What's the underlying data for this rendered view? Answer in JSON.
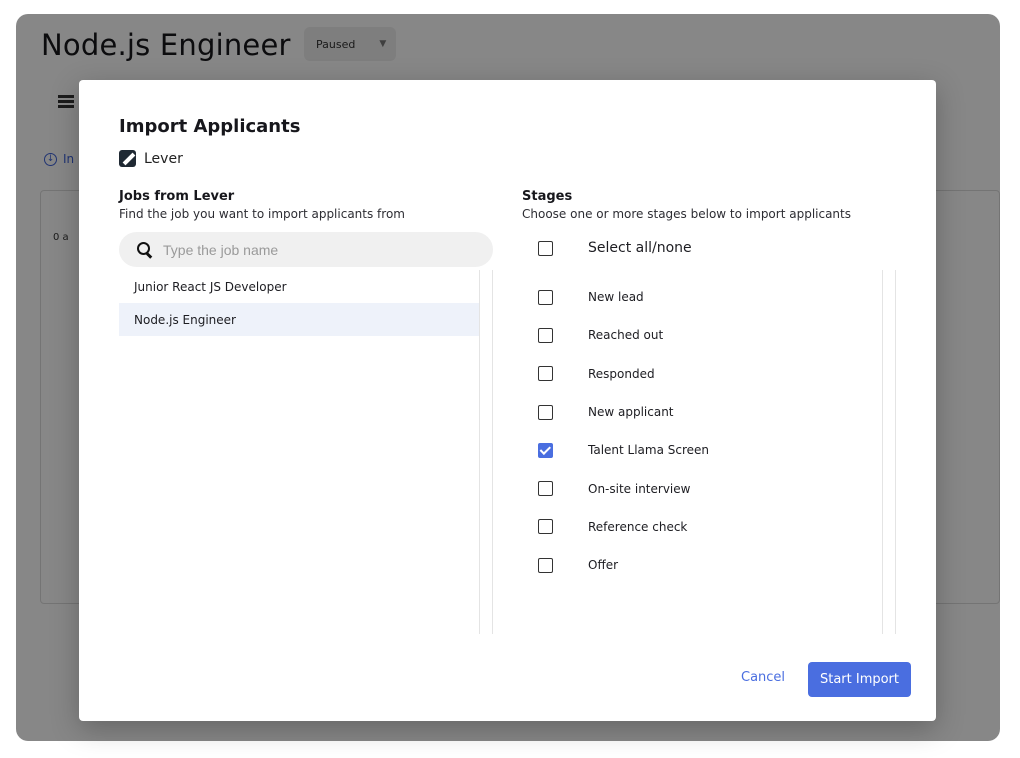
{
  "app": {
    "title": "Node.js Engineer",
    "status": "Paused",
    "import_link": "In",
    "count_text": "0 a"
  },
  "modal": {
    "title": "Import Applicants",
    "provider": "Lever",
    "jobs": {
      "title": "Jobs from Lever",
      "subtitle": "Find the job you want to import applicants from",
      "search_placeholder": "Type the job name",
      "items": [
        {
          "label": "Junior React JS Developer",
          "selected": false
        },
        {
          "label": "Node.js Engineer",
          "selected": true
        }
      ]
    },
    "stages": {
      "title": "Stages",
      "subtitle": "Choose one or more stages below to import applicants",
      "select_all_label": "Select all/none",
      "items": [
        {
          "label": "New lead",
          "checked": false
        },
        {
          "label": "Reached out",
          "checked": false
        },
        {
          "label": "Responded",
          "checked": false
        },
        {
          "label": "New applicant",
          "checked": false
        },
        {
          "label": "Talent Llama Screen",
          "checked": true
        },
        {
          "label": "On-site interview",
          "checked": false
        },
        {
          "label": "Reference check",
          "checked": false
        },
        {
          "label": "Offer",
          "checked": false
        }
      ]
    },
    "footer": {
      "cancel_label": "Cancel",
      "start_label": "Start Import"
    }
  },
  "colors": {
    "accent": "#4a6ee0",
    "overlay": "rgba(0,0,0,0.47)",
    "selected_row": "#eef2fa"
  },
  "icons": {
    "provider_logo": "lever-logo-icon",
    "search": "search-icon"
  }
}
